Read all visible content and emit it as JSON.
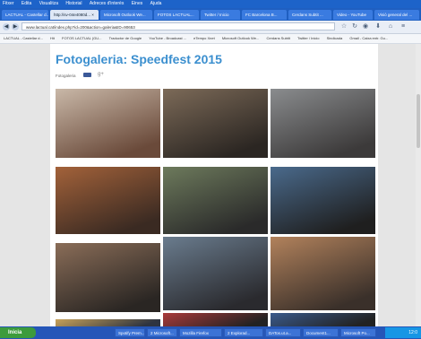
{
  "menu": [
    "Fitxer",
    "Edita",
    "Visualitza",
    "Historial",
    "Adreces d'interès",
    "Eines",
    "Ajuda"
  ],
  "tabs": [
    {
      "label": "LACTUAL - Castellar d...",
      "active": false
    },
    {
      "label": "http://sv-04e4080d... ×",
      "active": true
    },
    {
      "label": "Microsoft Outlook We...",
      "active": false
    },
    {
      "label": "FOTOS LACTUAL...",
      "active": false
    },
    {
      "label": "Twitter / Inicio",
      "active": false
    },
    {
      "label": "FC Barcelona B...",
      "active": false
    },
    {
      "label": "Cerdans Subtit ...",
      "active": false
    },
    {
      "label": "Video - YouTube",
      "active": false
    },
    {
      "label": "Visió general del ...",
      "active": false
    }
  ],
  "url": "www.lactual.cat/index.php?id=200&action=galeria&ID=90653",
  "bookmarks": [
    "LACTUAL - Castellar d...",
    "Hit",
    "FOTOS LACTUAL (GU...",
    "Traductor de Google",
    "YouTube - Broadcast ...",
    "eTempo Xnet",
    "Microsoft Outlook We...",
    "Cerdans Subtit",
    "Twitter / Inicio",
    "Sindicada",
    "Gmail - Caixa entr. Gu..."
  ],
  "page": {
    "title": "Fotogaleria: Speedfest 2015",
    "subtitle": "Fotogaleria"
  },
  "photos": [
    {
      "name": "photo-1",
      "c1": "#c9b8a8",
      "c2": "#6a4a3a"
    },
    {
      "name": "photo-2",
      "c1": "#7c6a58",
      "c2": "#2b2622"
    },
    {
      "name": "photo-3",
      "c1": "#8a8c8e",
      "c2": "#3c3a3a"
    },
    {
      "name": "photo-4",
      "c1": "#a3623a",
      "c2": "#3a2a22"
    },
    {
      "name": "photo-5",
      "c1": "#6d7a5c",
      "c2": "#2a2a2a"
    },
    {
      "name": "photo-6",
      "c1": "#4a6a8c",
      "c2": "#1f1f1f"
    },
    {
      "name": "photo-7",
      "c1": "#8a6d58",
      "c2": "#2a2623"
    },
    {
      "name": "photo-8",
      "c1": "#6a7c8e",
      "c2": "#2a2a2e"
    },
    {
      "name": "photo-9",
      "c1": "#b2825c",
      "c2": "#3a302a"
    },
    {
      "name": "photo-10",
      "c1": "#c8a25a",
      "c2": "#2e3440"
    },
    {
      "name": "photo-11",
      "c1": "#aa3a3a",
      "c2": "#222"
    },
    {
      "name": "photo-12",
      "c1": "#3a5a8c",
      "c2": "#222"
    }
  ],
  "taskbar": {
    "start": "Inicia",
    "items": [
      "Spotify Prem...",
      "2 Microsoft...",
      "Mozilla Firefox",
      "2 Explorad...",
      "DATos.ut.a...",
      "Document1...",
      "Microsoft Po..."
    ],
    "time": "12:0"
  },
  "colors": {
    "title": "#3b8fcf",
    "titlebar": "#1d63c9",
    "taskbar": "#2556b8"
  }
}
